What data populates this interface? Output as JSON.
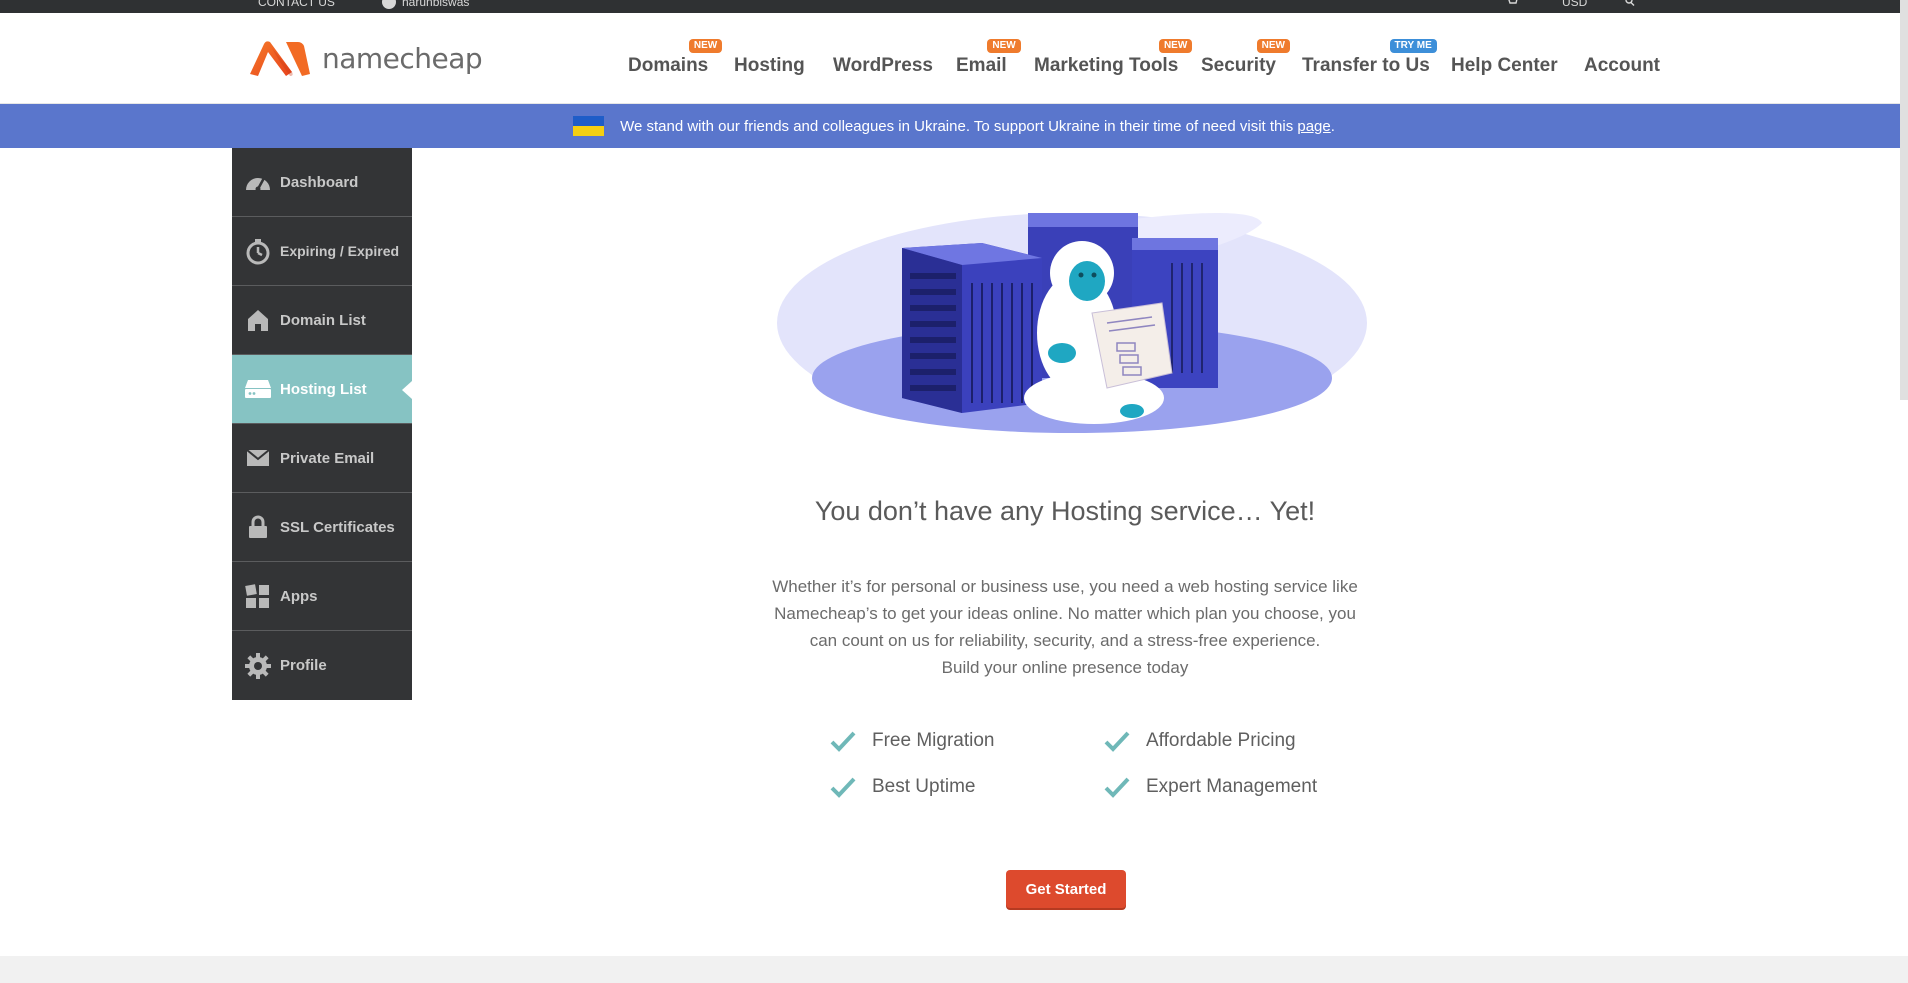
{
  "topbar": {
    "contact": "CONTACT US",
    "username": "harunbiswas",
    "currency": "USD"
  },
  "header": {
    "logo_text": "namecheap",
    "nav": [
      {
        "label": "Domains",
        "badge": "NEW"
      },
      {
        "label": "Hosting",
        "badge": ""
      },
      {
        "label": "WordPress",
        "badge": ""
      },
      {
        "label": "Email",
        "badge": "NEW"
      },
      {
        "label": "Marketing Tools",
        "badge": "NEW"
      },
      {
        "label": "Security",
        "badge": "NEW"
      },
      {
        "label": "Transfer to Us",
        "badge": "TRY ME"
      },
      {
        "label": "Help Center",
        "badge": ""
      },
      {
        "label": "Account",
        "badge": ""
      }
    ]
  },
  "banner": {
    "text": "We stand with our friends and colleagues in Ukraine. To support Ukraine in their time of need visit this ",
    "link_text": "page",
    "suffix": "."
  },
  "sidebar": {
    "items": [
      {
        "label": "Dashboard",
        "icon": "speedometer-icon"
      },
      {
        "label": "Expiring / Expired",
        "icon": "stopwatch-icon"
      },
      {
        "label": "Domain List",
        "icon": "house-icon"
      },
      {
        "label": "Hosting List",
        "icon": "server-icon",
        "active": true
      },
      {
        "label": "Private Email",
        "icon": "envelope-icon"
      },
      {
        "label": "SSL Certificates",
        "icon": "lock-icon"
      },
      {
        "label": "Apps",
        "icon": "apps-grid-icon"
      },
      {
        "label": "Profile",
        "icon": "gear-icon"
      }
    ]
  },
  "main": {
    "headline": "You don’t have any Hosting service… Yet!",
    "description_lines": [
      "Whether it’s for personal or business use, you need a web hosting service like",
      "Namecheap’s to get your ideas online. No matter which plan you choose, you",
      "can count on us for reliability, security, and a stress-free experience.",
      "Build your online presence today"
    ],
    "features": [
      "Free Migration",
      "Affordable Pricing",
      "Best Uptime",
      "Expert Management"
    ],
    "cta_label": "Get Started"
  },
  "colors": {
    "brand_orange": "#ef5a24",
    "banner_blue": "#5a76cc",
    "sidebar_dark": "#333436",
    "active_teal": "#86c3c3",
    "cta_red": "#dd4a2d",
    "check_teal": "#6fb8b8"
  }
}
